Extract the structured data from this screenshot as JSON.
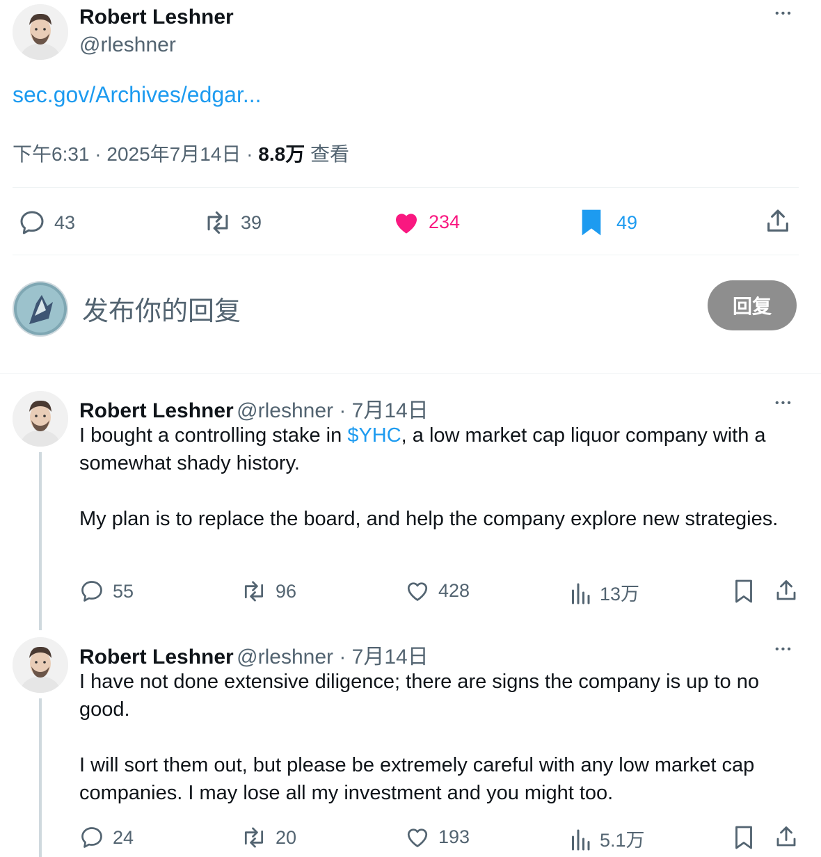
{
  "main_tweet": {
    "author_name": "Robert Leshner",
    "author_handle": "@rleshner",
    "link_text": "sec.gov/Archives/edgar...",
    "meta": {
      "time": "下午6:31",
      "sep1": " · ",
      "date": "2025年7月14日",
      "sep2": " · ",
      "views": "8.8万",
      "views_label": " 查看"
    },
    "actions": {
      "replies": "43",
      "retweets": "39",
      "likes": "234",
      "bookmarks": "49"
    },
    "colors": {
      "like": "#f91880",
      "bookmark": "#1d9bf0"
    }
  },
  "reply_box": {
    "placeholder": "发布你的回复",
    "button_label": "回复"
  },
  "thread": [
    {
      "author_name": "Robert Leshner",
      "author_handle": "@rleshner",
      "date": " · 7月14日",
      "text_before": "I bought a controlling stake in ",
      "cashtag": "$YHC",
      "text_after": ", a low market cap liquor company with a somewhat shady history.",
      "paragraph2": "My plan is to replace the board, and help the company explore new strategies.",
      "actions": {
        "replies": "55",
        "retweets": "96",
        "likes": "428",
        "views": "13万"
      }
    },
    {
      "author_name": "Robert Leshner",
      "author_handle": "@rleshner",
      "date": " · 7月14日",
      "paragraph1": "I have not done extensive diligence; there are signs the company is up to no good.",
      "paragraph2": "I will sort them out, but please be extremely careful with any low market cap companies. I may lose all my investment and you might too.",
      "actions": {
        "replies": "24",
        "retweets": "20",
        "likes": "193",
        "views": "5.1万"
      }
    }
  ],
  "icons": {
    "more": "more-horizontal-icon",
    "reply": "speech-bubble-icon",
    "retweet": "retweet-arrows-icon",
    "like": "heart-icon",
    "bookmark": "bookmark-icon",
    "share": "share-upload-icon",
    "views": "bar-chart-icon"
  },
  "more_glyph": "•••"
}
